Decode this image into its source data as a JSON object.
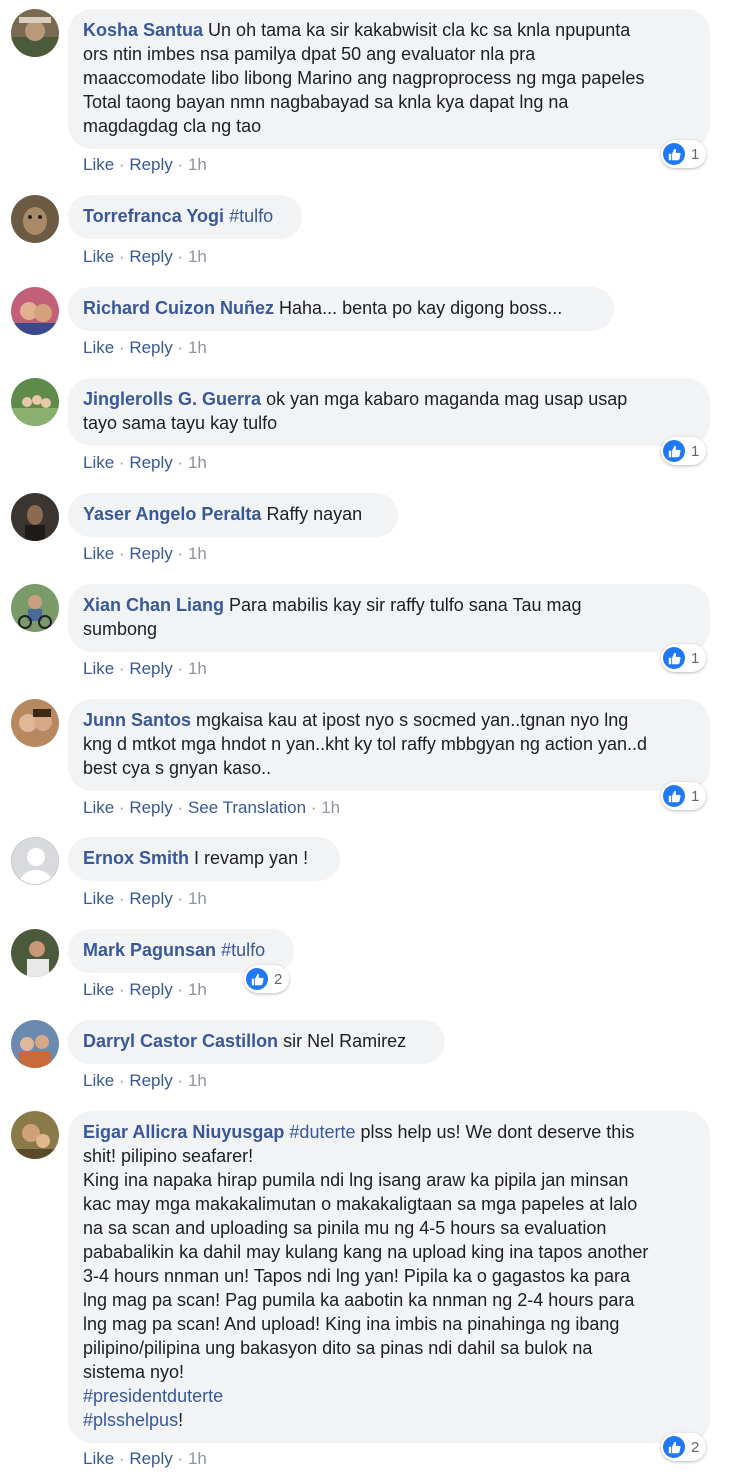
{
  "actions": {
    "like": "Like",
    "reply": "Reply",
    "translate": "See Translation",
    "sep": "·"
  },
  "comments": [
    {
      "author": "Kosha Santua",
      "time": "1h",
      "reactions": "1",
      "lines": [
        "Un oh tama ka sir kakabwisit cla kc sa knla npupunta",
        "ors ntin imbes nsa pamilya dpat 50 ang evaluator nla pra",
        "maaccomodate libo libong Marino ang nagproprocess ng mga papeles",
        "Total taong bayan nmn nagbabayad sa knla kya dapat lng na",
        "magdagdag cla ng tao"
      ]
    },
    {
      "author": "Torrefranca Yogi",
      "time": "1h",
      "tag": "#tulfo"
    },
    {
      "author": "Richard Cuizon Nuñez",
      "time": "1h",
      "text": "Haha... benta po kay digong boss..."
    },
    {
      "author": "Jinglerolls G. Guerra",
      "time": "1h",
      "reactions": "1",
      "lines": [
        "ok yan mga kabaro maganda mag usap usap",
        "tayo sama tayu kay tulfo"
      ]
    },
    {
      "author": "Yaser Angelo Peralta",
      "time": "1h",
      "text": "Raffy nayan"
    },
    {
      "author": "Xian Chan Liang",
      "time": "1h",
      "reactions": "1",
      "lines": [
        "Para mabilis kay sir raffy tulfo sana Tau mag",
        "sumbong"
      ]
    },
    {
      "author": "Junn Santos",
      "time": "1h",
      "reactions": "1",
      "lines": [
        "mgkaisa kau at ipost nyo s socmed yan..tgnan nyo lng",
        "kng d mtkot mga hndot n yan..kht ky tol raffy mbbgyan ng action yan..d",
        "best cya s gnyan kaso.."
      ]
    },
    {
      "author": "Ernox Smith",
      "time": "1h",
      "text": "I revamp yan !"
    },
    {
      "author": "Mark Pagunsan",
      "time": "1h",
      "tag": "#tulfo",
      "reactions": "2"
    },
    {
      "author": "Darryl Castor Castillon",
      "time": "1h",
      "text": "sir Nel Ramirez"
    },
    {
      "author": "Eigar Allicra Niuyusgap",
      "time": "1h",
      "reactions": "2",
      "tag": "#duterte",
      "first": "plss help us! We dont deserve this",
      "lines": [
        "shit! pilipino seafarer!",
        "King ina napaka hirap pumila ndi lng isang araw ka pipila jan minsan",
        "kac may mga makakalimutan o makakaligtaan sa mga papeles at lalo",
        "na sa scan and uploading sa pinila mu ng 4-5 hours sa evaluation",
        "pababalikin ka dahil may kulang kang na upload king ina tapos another",
        "3-4 hours nnman un! Tapos ndi lng yan! Pipila ka o gagastos ka para",
        "lng mag pa scan! Pag pumila ka aabotin ka nnman ng 2-4 hours para",
        "lng mag pa scan! And upload! King ina imbis na pinahinga ng ibang",
        "pilipino/pilipina ung bakasyon dito sa pinas ndi dahil sa bulok na",
        "sistema nyo!"
      ],
      "tag2": "#presidentduterte",
      "tag3": "#plsshelpus",
      "tag3_suffix": "!"
    }
  ]
}
